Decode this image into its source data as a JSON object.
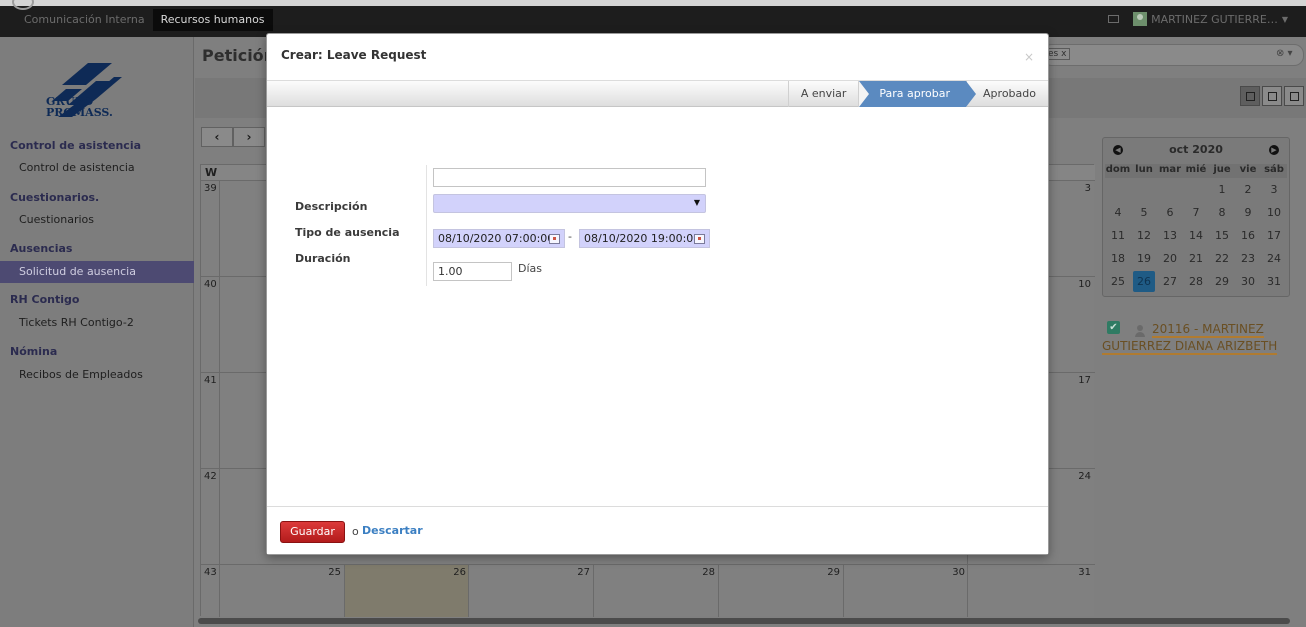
{
  "topbar": {
    "menu": [
      "Comunicación Interna",
      "Recursos humanos"
    ],
    "user_name": "MARTINEZ GUTIERRE…"
  },
  "sidebar": {
    "logo_line1": "GRUPO",
    "logo_line2": "PROMASS.",
    "sections": [
      {
        "title": "Control de asistencia",
        "items": [
          "Control de asistencia"
        ]
      },
      {
        "title": "Cuestionarios.",
        "items": [
          "Cuestionarios"
        ]
      },
      {
        "title": "Ausencias",
        "items": [
          "Solicitud de ausencia"
        ]
      },
      {
        "title": "RH Contigo",
        "items": [
          "Tickets RH Contigo-2"
        ]
      },
      {
        "title": "Nómina",
        "items": [
          "Recibos de Empleados"
        ]
      }
    ]
  },
  "main": {
    "title": "Petición",
    "search_tag": "es x",
    "nav_prev": "‹",
    "nav_next": "›",
    "calendar": {
      "week_header": "W",
      "rows": [
        {
          "week": "39",
          "last_day": "3"
        },
        {
          "week": "40",
          "last_day": "10"
        },
        {
          "week": "41",
          "last_day": "17"
        },
        {
          "week": "42",
          "last_day": "24"
        },
        {
          "week": "43",
          "days": [
            "25",
            "26",
            "27",
            "28",
            "29",
            "30",
            "31"
          ]
        }
      ]
    }
  },
  "minical": {
    "month": "oct 2020",
    "dow": [
      "dom",
      "lun",
      "mar",
      "mié",
      "jue",
      "vie",
      "sáb"
    ],
    "days": [
      "",
      "",
      "",
      "",
      "1",
      "2",
      "3",
      "4",
      "5",
      "6",
      "7",
      "8",
      "9",
      "10",
      "11",
      "12",
      "13",
      "14",
      "15",
      "16",
      "17",
      "18",
      "19",
      "20",
      "21",
      "22",
      "23",
      "24",
      "25",
      "26",
      "27",
      "28",
      "29",
      "30",
      "31"
    ],
    "selected": "26"
  },
  "employee_filter": {
    "label": "20116 - MARTINEZ GUTIERREZ DIANA ARIZBETH"
  },
  "modal": {
    "title": "Crear: Leave Request",
    "close": "×",
    "steps": [
      "A enviar",
      "Para aprobar",
      "Aprobado"
    ],
    "active_step": "Para aprobar",
    "fields": {
      "description_label": "Descripción",
      "description_value": "",
      "type_label": "Tipo de ausencia",
      "type_value": "",
      "duration_label": "Duración",
      "date_from": "08/10/2020 07:00:00",
      "date_to": "08/10/2020 19:00:00",
      "date_separator": "-",
      "days_value": "1.00",
      "days_label": "Días"
    },
    "footer": {
      "save_label": "Guardar",
      "or_label": "o",
      "discard_label": "Descartar"
    }
  }
}
